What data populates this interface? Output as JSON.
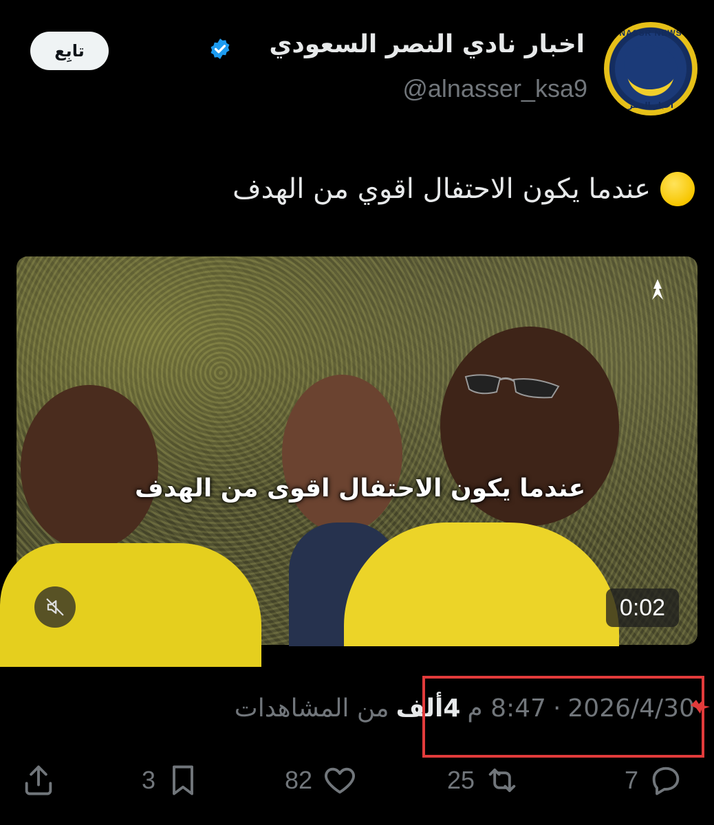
{
  "account": {
    "display_name": "اخبار نادي النصر السعودي",
    "handle": "@alnasser_ksa9",
    "avatar_text_top": "NASSR NEWS",
    "avatar_text_bottom": "أخبار النصر",
    "follow_label": "تابِع"
  },
  "tweet": {
    "text": "عندما يكون الاحتفال اقوي من الهدف"
  },
  "media": {
    "caption": "عندما يكون الاحتفال اقوى من الهدف",
    "duration": "0:02"
  },
  "meta": {
    "date": "2026/4/30",
    "separator": "·",
    "time": "8:47 م",
    "views_count": "4ألف",
    "views_label": "من المشاهدات"
  },
  "actions": {
    "reply_count": "7",
    "retweet_count": "25",
    "like_count": "82",
    "bookmark_count": "3"
  },
  "colors": {
    "background": "#000000",
    "verified": "#1d9bf0",
    "highlight": "#e23b3b",
    "muted_text": "#71767b"
  }
}
